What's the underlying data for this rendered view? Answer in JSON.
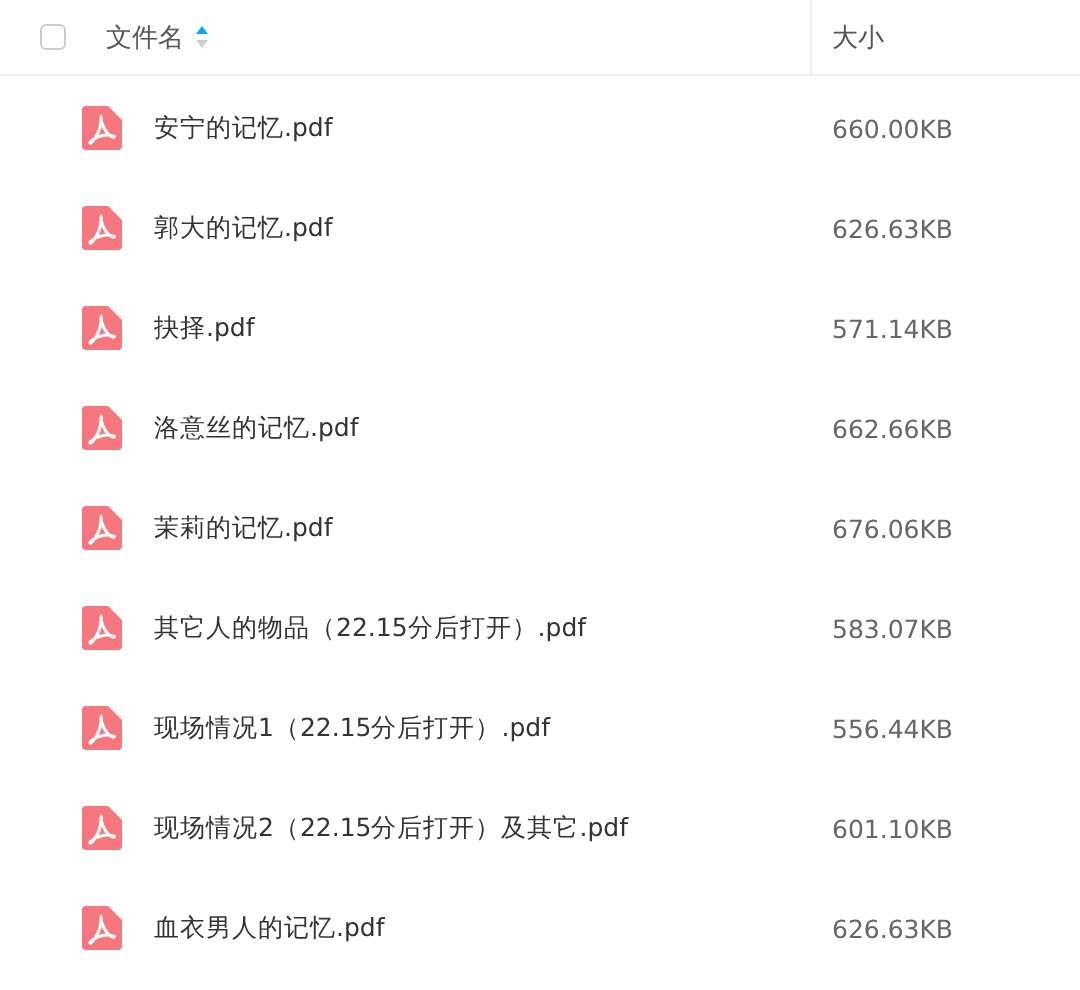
{
  "header": {
    "select_all": {
      "checked": false
    },
    "columns": [
      {
        "label": "文件名",
        "sorted": true,
        "ascending": true
      },
      {
        "label": "大小",
        "sorted": false
      }
    ]
  },
  "files": [
    {
      "name": "安宁的记忆.pdf",
      "size": "660.00KB"
    },
    {
      "name": "郭大的记忆.pdf",
      "size": "626.63KB"
    },
    {
      "name": "抉择.pdf",
      "size": "571.14KB"
    },
    {
      "name": "洛意丝的记忆.pdf",
      "size": "662.66KB"
    },
    {
      "name": "茉莉的记忆.pdf",
      "size": "676.06KB"
    },
    {
      "name": "其它人的物品（22.15分后打开）.pdf",
      "size": "583.07KB"
    },
    {
      "name": "现场情况1（22.15分后打开）.pdf",
      "size": "556.44KB"
    },
    {
      "name": "现场情况2（22.15分后打开）及其它.pdf",
      "size": "601.10KB"
    },
    {
      "name": "血衣男人的记忆.pdf",
      "size": "626.63KB"
    }
  ]
}
